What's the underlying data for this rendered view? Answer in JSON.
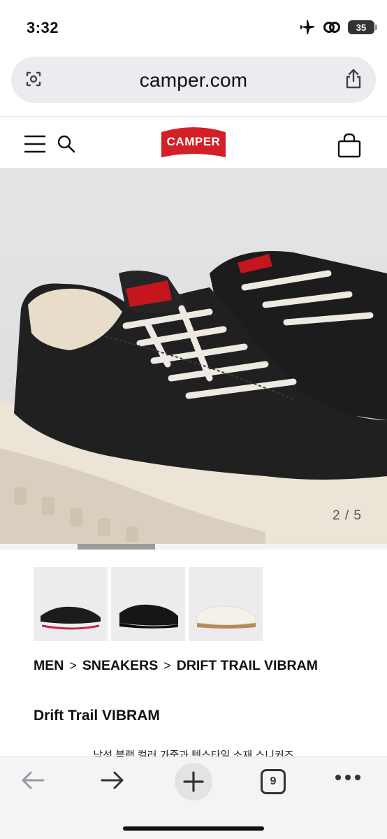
{
  "status_bar": {
    "time": "3:32",
    "battery": "35",
    "icons": [
      "airplane-icon",
      "link-icon",
      "battery-icon"
    ]
  },
  "browser": {
    "url": "camper.com",
    "tab_count": "9",
    "toolbar_icons": [
      "back-icon",
      "forward-icon",
      "plus-icon",
      "tabs-icon",
      "more-icon"
    ]
  },
  "site_header": {
    "logo_text": "CAMPER",
    "brand_color": "#d51f26",
    "icons": [
      "menu-icon",
      "search-icon",
      "bag-icon"
    ]
  },
  "gallery": {
    "counter": "2 / 5",
    "progress": 0.2,
    "thumbnails": [
      {
        "name": "thumb-black-red-sole"
      },
      {
        "name": "thumb-all-black"
      },
      {
        "name": "thumb-white"
      }
    ]
  },
  "breadcrumb": {
    "items": [
      "MEN",
      "SNEAKERS",
      "DRIFT TRAIL VIBRAM"
    ],
    "separator": ">"
  },
  "product": {
    "title": "Drift Trail VIBRAM",
    "subtitle": "남성 블랙 컬러 가죽과 텍스타일 소재 스니커즈"
  }
}
